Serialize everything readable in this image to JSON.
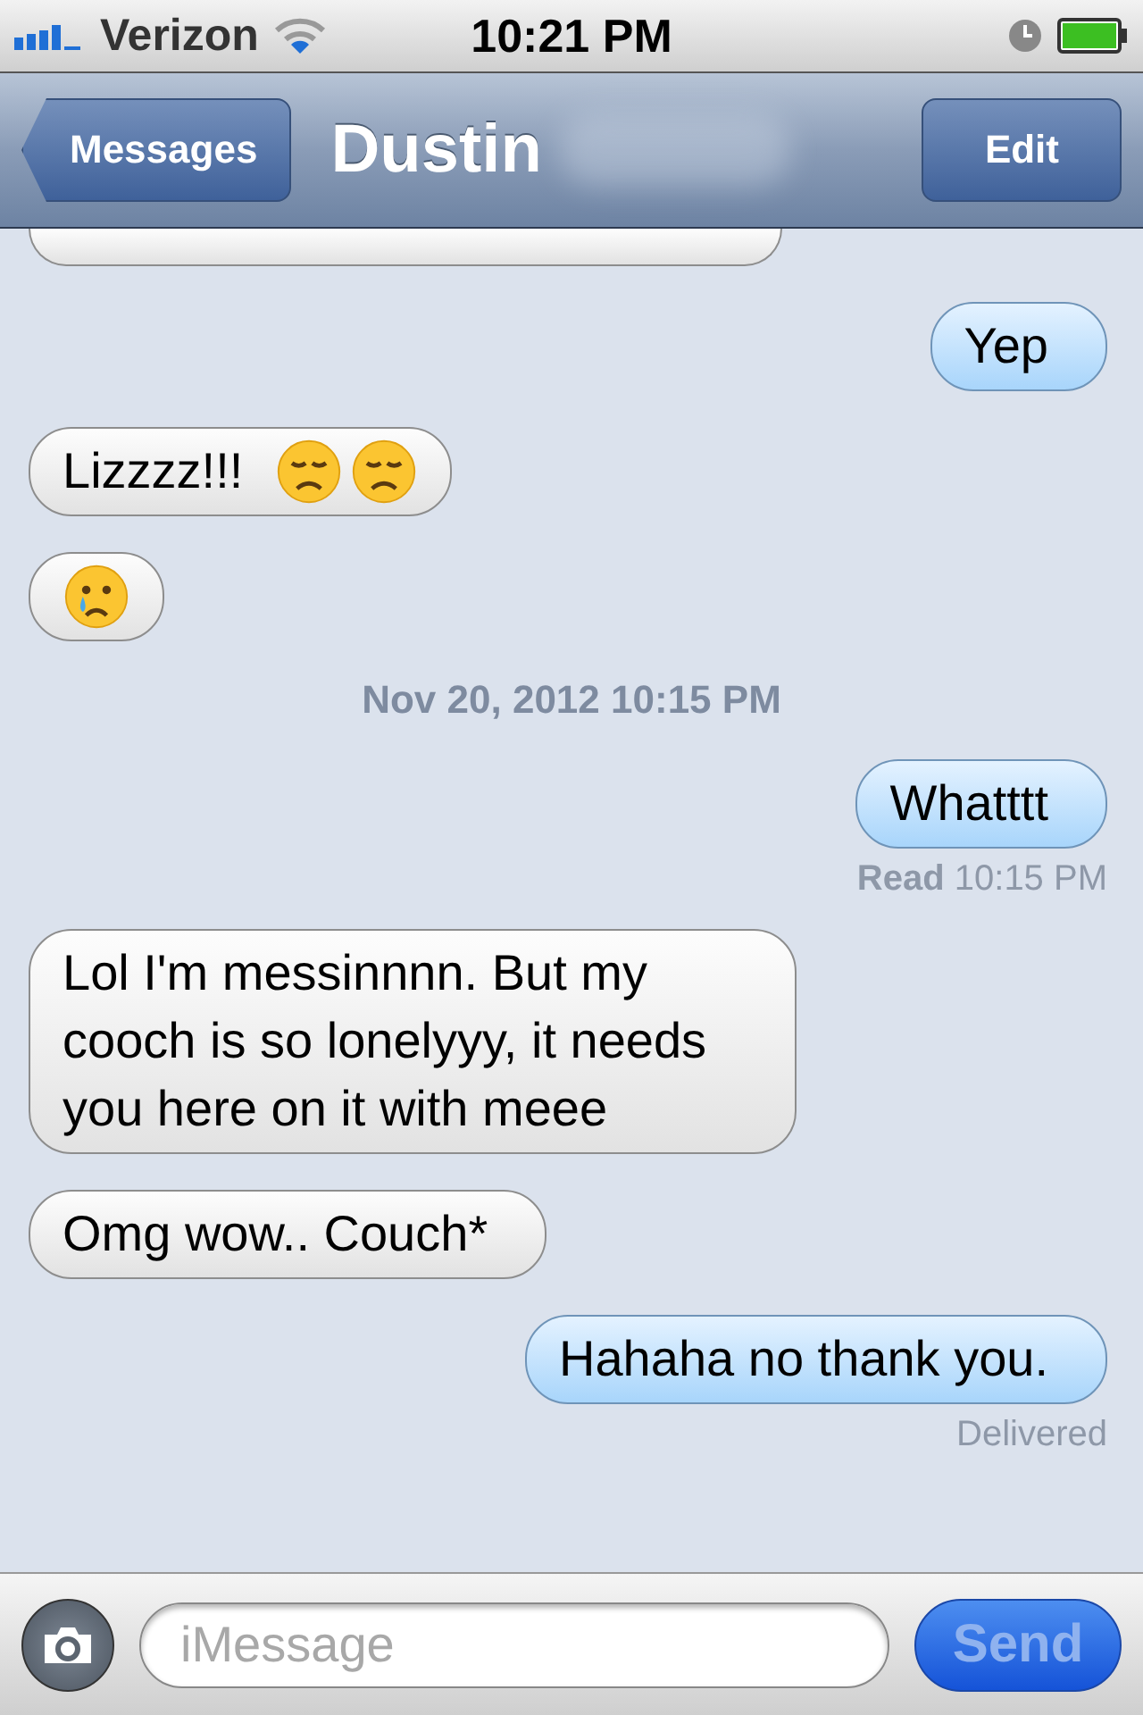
{
  "status_bar": {
    "carrier": "Verizon",
    "time": "10:21 PM"
  },
  "nav": {
    "back": "Messages",
    "title": "Dustin",
    "edit": "Edit"
  },
  "messages": [
    {
      "kind": "cut",
      "outgoing": false
    },
    {
      "kind": "bubble",
      "outgoing": true,
      "text": "Yep"
    },
    {
      "kind": "bubble",
      "outgoing": false,
      "text": "Lizzzz!!!",
      "emoji": [
        {
          "kind": "sad"
        },
        {
          "kind": "sad"
        }
      ]
    },
    {
      "kind": "bubble",
      "outgoing": false,
      "emoji": [
        {
          "kind": "crying"
        }
      ]
    },
    {
      "kind": "timestamp",
      "text": "Nov 20, 2012 10:15 PM"
    },
    {
      "kind": "bubble",
      "outgoing": true,
      "text": "Whatttt"
    },
    {
      "kind": "status",
      "text": "**Read**  10:15 PM"
    },
    {
      "kind": "bubble",
      "outgoing": false,
      "text": "Lol I'm messinnnn.  But my cooch is so lonelyyy, it needs you here on it with meee"
    },
    {
      "kind": "bubble",
      "outgoing": false,
      "text": "Omg wow..  Couch*"
    },
    {
      "kind": "bubble",
      "outgoing": true,
      "text": "Hahaha no thank you."
    },
    {
      "kind": "status",
      "text": "Delivered"
    }
  ],
  "composer": {
    "placeholder": "iMessage",
    "send": "Send",
    "send_disabled": true
  }
}
